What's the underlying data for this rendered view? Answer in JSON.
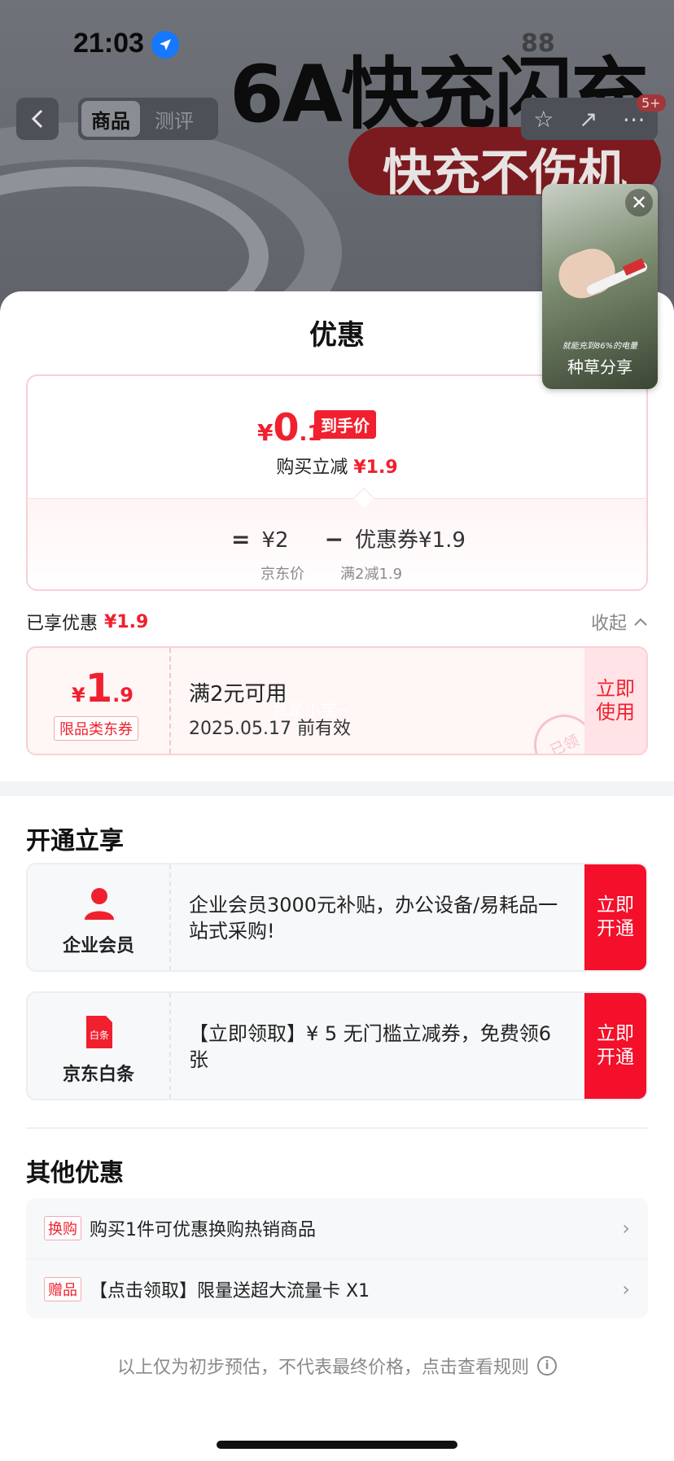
{
  "status_bar": {
    "time": "21:03",
    "right_text": "88"
  },
  "background_page": {
    "headline": "6A快充闪充",
    "pill_text": "快充不伤机",
    "tabs": [
      {
        "label": "商品"
      },
      {
        "label": "测评"
      }
    ],
    "cart_badge": "5+"
  },
  "floating_video": {
    "caption": "就能充到86%的电量",
    "label": "种草分享"
  },
  "sheet": {
    "title": "优惠",
    "price_summary": {
      "final_currency": "¥",
      "final_int": "0",
      "final_dec": ".1",
      "final_tag": "到手价",
      "instant_cut_label": "购买立减",
      "instant_cut_amount": "¥1.9",
      "jd_price_op": "=",
      "jd_price": "¥2",
      "jd_price_label": "京东价",
      "coupon_op": "−",
      "coupon_text": "优惠券¥1.9",
      "coupon_rule": "满2减1.9"
    },
    "enjoyed": {
      "label": "已享优惠",
      "amount": "¥1.9",
      "collapse": "收起"
    },
    "coupon": {
      "currency": "¥",
      "int": "1",
      "dec": ".9",
      "type": "限品类东券",
      "condition": "满2元可用",
      "expiry": "2025.05.17 前有效",
      "button": "立即\n使用",
      "stamp": "已领",
      "watermark": "我是小宝~"
    },
    "open_section": {
      "title": "开通立享",
      "items": [
        {
          "name": "企业会员",
          "text": " 企业会员3000元补贴，办公设备/易耗品一站式采购!",
          "button": "立即\n开通",
          "icon": "person-icon"
        },
        {
          "name": "京东白条",
          "text": "【立即领取】¥ 5 无门槛立减券，免费领6张",
          "button": "立即\n开通",
          "icon": "baitiao-icon",
          "icon_text": "白条"
        }
      ]
    },
    "other_section": {
      "title": "其他优惠",
      "items": [
        {
          "tag": "换购",
          "text": "购买1件可优惠换购热销商品"
        },
        {
          "tag": "赠品",
          "text": "【点击领取】限量送超大流量卡 X1"
        }
      ]
    },
    "disclaimer": "以上仅为初步预估，不代表最终价格，点击查看规则"
  },
  "colors": {
    "accent": "#f0202e",
    "button_red": "#f40f2a",
    "coupon_bg": "#fff6f6"
  }
}
